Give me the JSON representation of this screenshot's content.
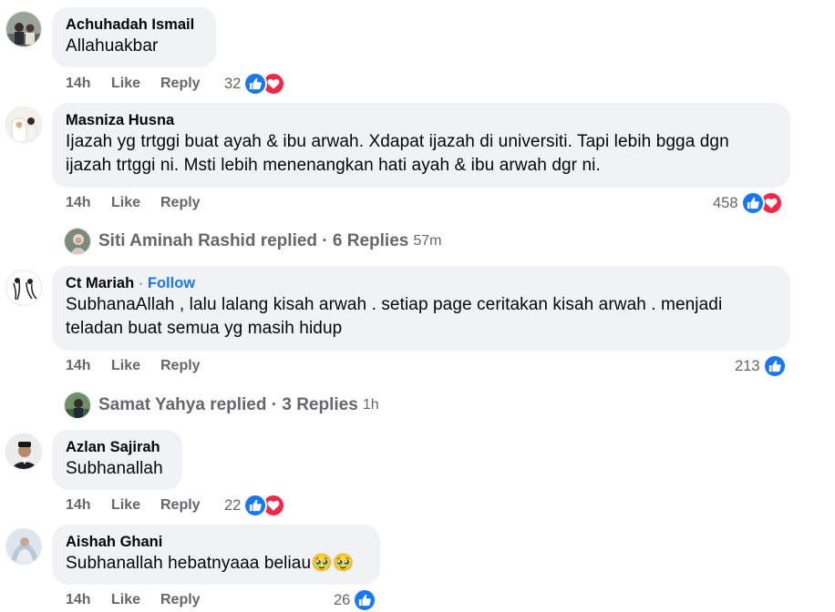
{
  "colors": {
    "bubble_bg": "#f0f2f5",
    "meta_text": "#65676b",
    "like_blue": "#1877f2",
    "love_red": "#f0284a",
    "follow_blue": "#1877f2"
  },
  "action_labels": {
    "like": "Like",
    "reply": "Reply"
  },
  "comments": [
    {
      "author": "Achuhadah Ismail",
      "text": [
        "Allahuakbar"
      ],
      "time": "14h",
      "reaction_count": "32",
      "reactions": [
        "like-icon",
        "love-icon"
      ]
    },
    {
      "author": "Masniza Husna",
      "text": [
        "Ijazah yg trtggi buat ayah & ibu arwah. Xdapat ijazah di universiti. Tapi lebih bgga dgn",
        "ijazah trtggi ni. Msti lebih menenangkan hati ayah & ibu arwah dgr ni."
      ],
      "time": "14h",
      "reaction_count": "458",
      "reactions": [
        "like-icon",
        "love-icon"
      ],
      "replies_summary": {
        "replier": "Siti Aminah Rashid",
        "label": "replied · 6 Replies",
        "time": "57m"
      }
    },
    {
      "author": "Ct Mariah",
      "separator": "·",
      "follow_label": "Follow",
      "text": [
        "SubhanaAllah , lalu lalang kisah arwah . setiap page ceritakan kisah arwah . menjadi",
        "teladan buat semua yg masih hidup"
      ],
      "time": "14h",
      "reaction_count": "213",
      "reactions": [
        "like-icon"
      ],
      "replies_summary": {
        "replier": "Samat Yahya",
        "label": "replied · 3 Replies",
        "time": "1h"
      }
    },
    {
      "author": "Azlan Sajirah",
      "text": [
        "Subhanallah"
      ],
      "time": "14h",
      "reaction_count": "22",
      "reactions": [
        "like-icon",
        "love-icon"
      ]
    },
    {
      "author": "Aishah Ghani",
      "text": [
        "Subhanallah hebatnyaaa beliau"
      ],
      "emoji": "🥹🥹",
      "time": "14h",
      "reaction_count": "26",
      "reactions": [
        "like-icon"
      ]
    }
  ]
}
